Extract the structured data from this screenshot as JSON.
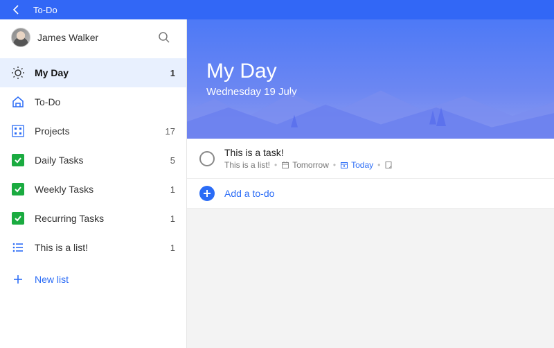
{
  "titlebar": {
    "title": "To-Do"
  },
  "profile": {
    "name": "James Walker"
  },
  "sidebar": {
    "items": [
      {
        "label": "My Day",
        "count": "1",
        "icon": "sun",
        "active": true
      },
      {
        "label": "To-Do",
        "count": "",
        "icon": "home",
        "active": false
      },
      {
        "label": "Projects",
        "count": "17",
        "icon": "grid",
        "active": false
      },
      {
        "label": "Daily Tasks",
        "count": "5",
        "icon": "check",
        "active": false
      },
      {
        "label": "Weekly Tasks",
        "count": "1",
        "icon": "check",
        "active": false
      },
      {
        "label": "Recurring Tasks",
        "count": "1",
        "icon": "check",
        "active": false
      },
      {
        "label": "This is a list!",
        "count": "1",
        "icon": "list",
        "active": false
      }
    ],
    "new_list_label": "New list"
  },
  "hero": {
    "title": "My Day",
    "date": "Wednesday 19 July"
  },
  "tasks": [
    {
      "title": "This is a task!",
      "list": "This is a list!",
      "due": "Tomorrow",
      "reminder": "Today",
      "has_note": true
    }
  ],
  "add_placeholder": "Add a to-do",
  "colors": {
    "accent": "#2b6cf6",
    "titlebar": "#3267f6"
  }
}
